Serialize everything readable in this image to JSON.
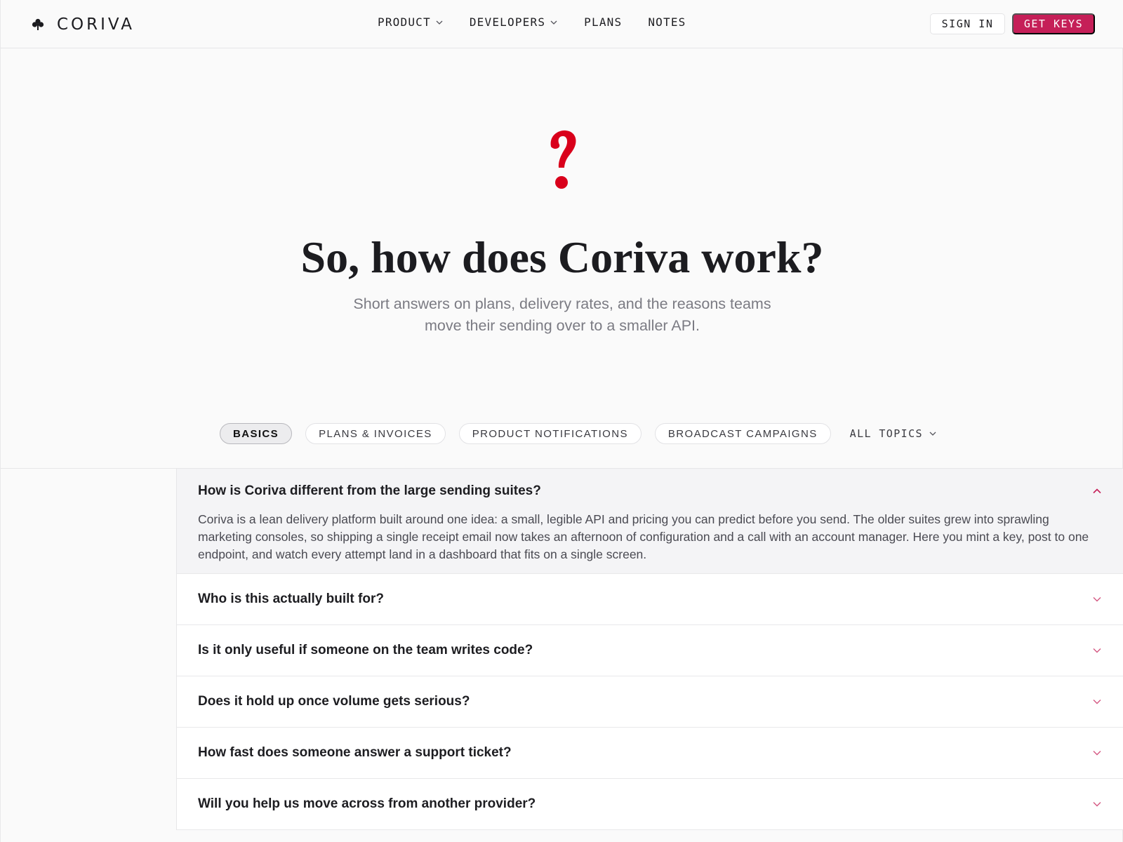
{
  "brand": {
    "name": "CORIVA",
    "logo_icon": "clover-icon"
  },
  "nav": {
    "links": [
      {
        "label": "PRODUCT",
        "dropdown": true
      },
      {
        "label": "DEVELOPERS",
        "dropdown": true
      },
      {
        "label": "PLANS",
        "dropdown": false
      },
      {
        "label": "NOTES",
        "dropdown": false
      }
    ],
    "sign_in": "SIGN IN",
    "get_keys": "GET KEYS"
  },
  "hero": {
    "icon": "question-mark-icon",
    "title": "So, how does Coriva work?",
    "subtitle": "Short answers on plans, delivery rates, and the reasons teams move their sending over to a smaller API."
  },
  "topics": {
    "pills": [
      "BASICS",
      "PLANS & INVOICES",
      "PRODUCT NOTIFICATIONS",
      "BROADCAST CAMPAIGNS"
    ],
    "active": "BASICS",
    "all_topics": "ALL TOPICS"
  },
  "faq": [
    {
      "question": "How is Coriva different from the large sending suites?",
      "answer": "Coriva is a lean delivery platform built around one idea: a small, legible API and pricing you can predict before you send. The older suites grew into sprawling marketing consoles, so shipping a single receipt email now takes an afternoon of configuration and a call with an account manager. Here you mint a key, post to one endpoint, and watch every attempt land in a dashboard that fits on a single screen.",
      "open": true
    },
    {
      "question": "Who is this actually built for?",
      "open": false
    },
    {
      "question": "Is it only useful if someone on the team writes code?",
      "open": false
    },
    {
      "question": "Does it hold up once volume gets serious?",
      "open": false
    },
    {
      "question": "How fast does someone answer a support ticket?",
      "open": false
    },
    {
      "question": "Will you help us move across from another provider?",
      "open": false
    }
  ],
  "colors": {
    "accent": "#c51f58",
    "question_mark": "#d9001b",
    "chevron": "#c51f58"
  }
}
